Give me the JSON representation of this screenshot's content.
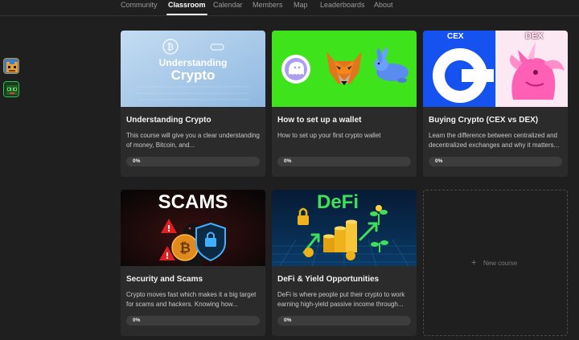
{
  "nav": {
    "tabs": [
      {
        "label": "Community",
        "active": false
      },
      {
        "label": "Classroom",
        "active": true
      },
      {
        "label": "Calendar",
        "active": false
      },
      {
        "label": "Members",
        "active": false
      },
      {
        "label": "Map",
        "active": false
      },
      {
        "label": "Leaderboards",
        "active": false
      },
      {
        "label": "About",
        "active": false
      }
    ]
  },
  "courses": [
    {
      "title": "Understanding Crypto",
      "description": "This course will give you a clear understanding of money, Bitcoin, and...",
      "progress_label": "0%",
      "progress": 0,
      "thumb_text": [
        "Understanding",
        "Crypto"
      ]
    },
    {
      "title": "How to set up a wallet",
      "description": "How to set up your first crypto wallet",
      "progress_label": "0%",
      "progress": 0
    },
    {
      "title": "Buying Crypto (CEX vs DEX)",
      "description": "Learn the difference between centralized and decentralized exchanges and why it matters...",
      "progress_label": "0%",
      "progress": 0,
      "thumb_text": [
        "CEX",
        "DEX"
      ]
    },
    {
      "title": "Security and Scams",
      "description": "Crypto moves fast which makes it a big target for scams and hackers. Knowing how...",
      "progress_label": "0%",
      "progress": 0,
      "thumb_text": [
        "SCAMS"
      ]
    },
    {
      "title": "DeFi & Yield Opportunities",
      "description": "DeFi is where people put their crypto to work earning high-yield passive income through...",
      "progress_label": "0%",
      "progress": 0,
      "thumb_text": [
        "DeFi"
      ]
    }
  ],
  "new_course": {
    "label": "New course",
    "icon": "plus-icon"
  },
  "colors": {
    "background": "#1f1f1f",
    "card": "#2b2b2b",
    "wallet_green": "#3fe31c",
    "cex_blue": "#1652f0",
    "dex_pink": "#ff5fb4"
  }
}
